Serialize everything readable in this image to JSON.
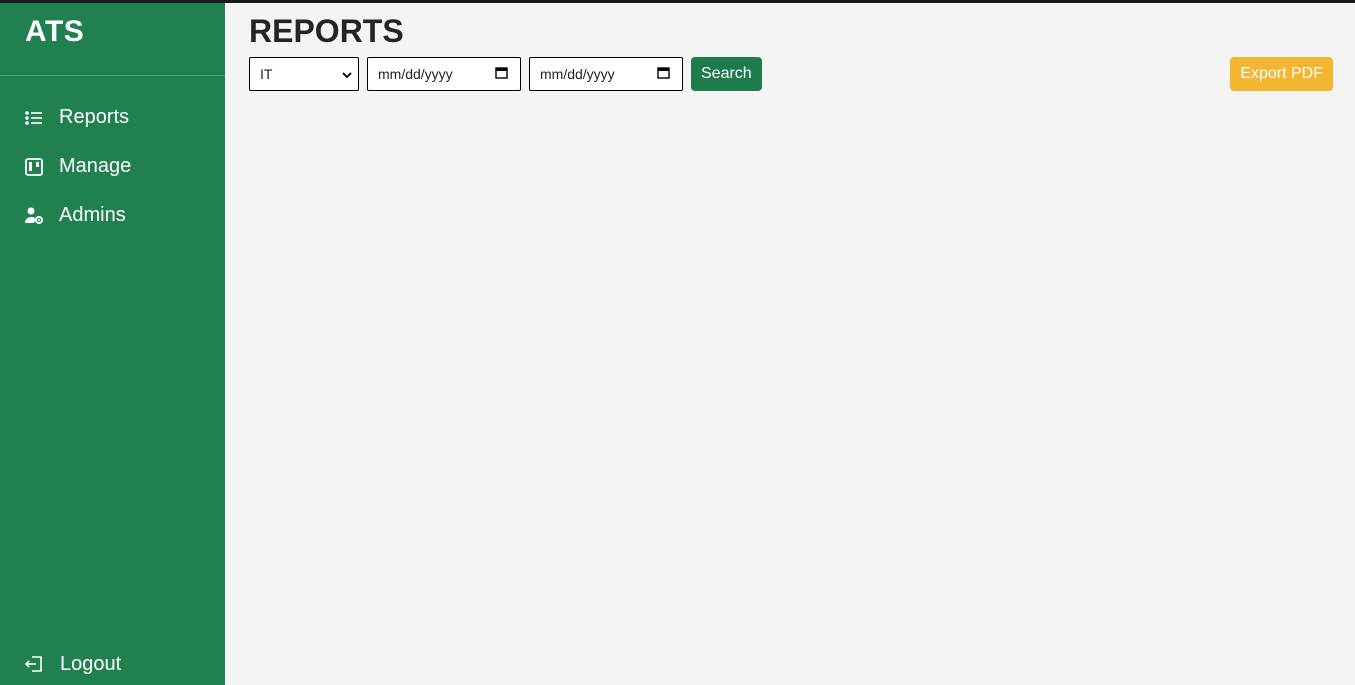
{
  "app": {
    "brand": "ATS"
  },
  "sidebar": {
    "items": [
      {
        "label": "Reports",
        "icon": "list-icon"
      },
      {
        "label": "Manage",
        "icon": "board-icon"
      },
      {
        "label": "Admins",
        "icon": "user-gear-icon"
      }
    ],
    "logout": {
      "label": "Logout",
      "icon": "logout-icon"
    }
  },
  "main": {
    "title": "REPORTS",
    "filters": {
      "department": {
        "value": "IT"
      },
      "start_date": {
        "placeholder": "mm/dd/yyyy"
      },
      "end_date": {
        "placeholder": "mm/dd/yyyy"
      }
    },
    "search_label": "Search",
    "export_label": "Export PDF"
  },
  "colors": {
    "sidebar_bg": "#208050",
    "search_btn": "#1e7b4c",
    "export_btn": "#f2b632",
    "page_bg": "#f4f4f4"
  }
}
